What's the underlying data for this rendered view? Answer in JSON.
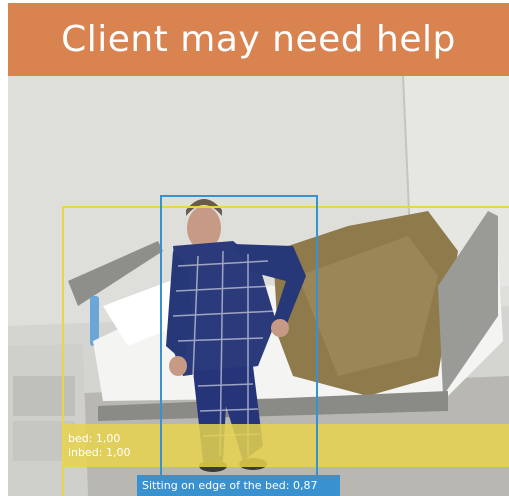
{
  "alert": {
    "message": "Client may need help",
    "color": "#d98351"
  },
  "detections": {
    "bed_label": "bed: 1,00",
    "inbed_label": "inbed: 1,00",
    "person_label": "Sitting on edge of the bed: 0,87",
    "bed_box_color": "#e8d44d",
    "person_box_color": "#3a91cf"
  }
}
